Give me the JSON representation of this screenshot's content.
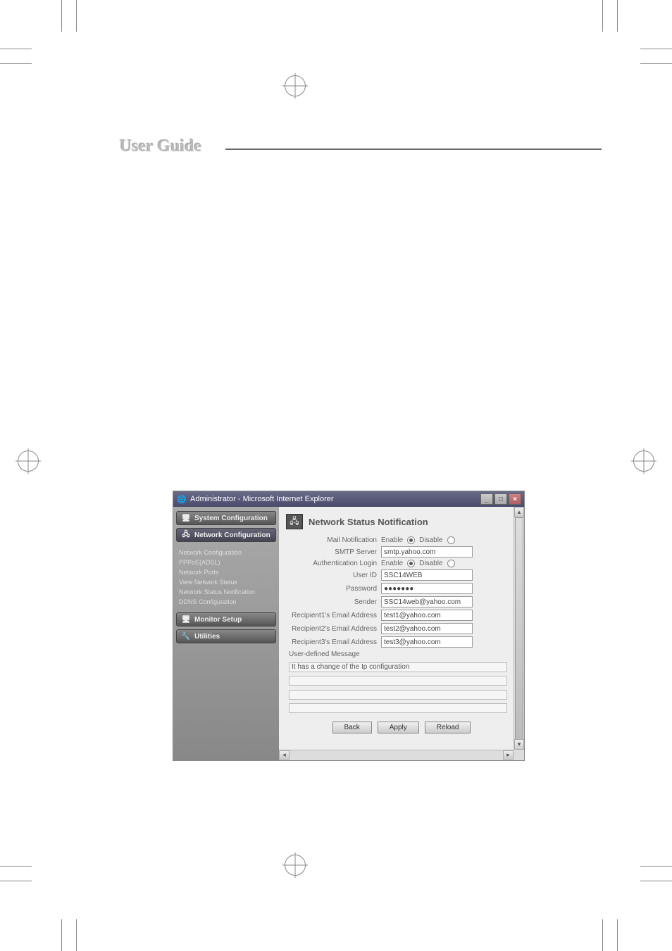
{
  "page_title": "User Guide",
  "window": {
    "title": "Administrator - Microsoft Internet Explorer",
    "controls": {
      "min": "_",
      "max": "□",
      "close": "×"
    }
  },
  "sidebar": {
    "system_config": "System Configuration",
    "network_config": "Network Configuration",
    "sub_items": [
      "Network Configuration",
      "PPPoE(ADSL)",
      "Network Ports",
      "View Network Status",
      "Network Status Notification",
      "DDNS Configuration"
    ],
    "monitor_setup": "Monitor Setup",
    "utilities": "Utilities"
  },
  "content": {
    "title": "Network Status Notification",
    "labels": {
      "mail_notification": "Mail Notification",
      "smtp_server": "SMTP Server",
      "auth_login": "Authentication Login",
      "user_id": "User ID",
      "password": "Password",
      "sender": "Sender",
      "recip1": "Recipient1's Email Address",
      "recip2": "Recipient2's Email Address",
      "recip3": "Recipient3's Email Address",
      "user_msg": "User-defined Message",
      "enable": "Enable",
      "disable": "Disable"
    },
    "values": {
      "smtp_server": "smtp.yahoo.com",
      "user_id": "SSC14WEB",
      "password": "●●●●●●●",
      "sender": "SSC14web@yahoo.com",
      "recip1": "test1@yahoo.com",
      "recip2": "test2@yahoo.com",
      "recip3": "test3@yahoo.com",
      "msg1": "It has a change of the Ip configuration"
    },
    "buttons": {
      "back": "Back",
      "apply": "Apply",
      "reload": "Reload"
    }
  }
}
